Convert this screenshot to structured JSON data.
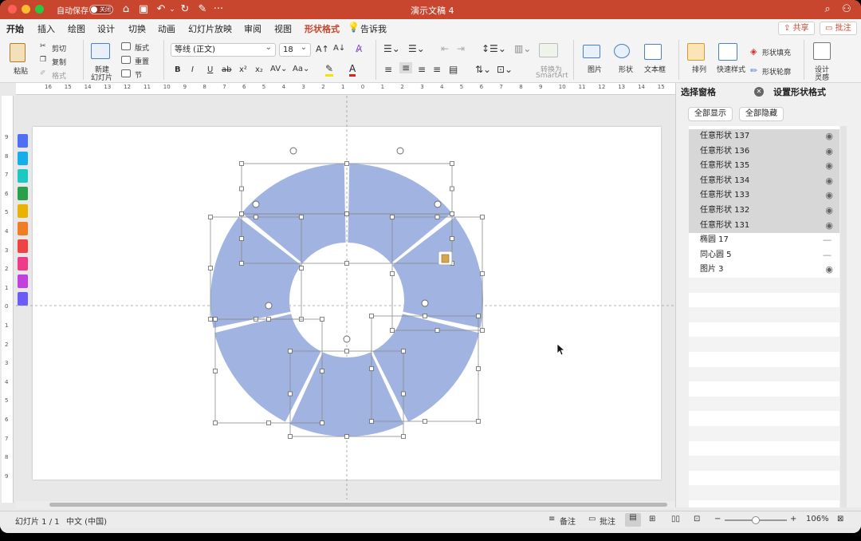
{
  "titlebar": {
    "autosave_label": "自动保存",
    "autosave_state": "关闭",
    "doc_title": "演示文稿 4",
    "more_icon": "···"
  },
  "tabs": [
    {
      "label": "开始"
    },
    {
      "label": "插入"
    },
    {
      "label": "绘图"
    },
    {
      "label": "设计"
    },
    {
      "label": "切换"
    },
    {
      "label": "动画"
    },
    {
      "label": "幻灯片放映"
    },
    {
      "label": "审阅"
    },
    {
      "label": "视图"
    },
    {
      "label": "形状格式"
    },
    {
      "label": "告诉我"
    }
  ],
  "share_label": "共享",
  "comment_label": "批注",
  "ribbon": {
    "paste": "粘贴",
    "cut": "剪切",
    "copy": "复制",
    "format": "格式",
    "new_slide_1": "新建",
    "new_slide_2": "幻灯片",
    "layout": "版式",
    "reset": "重置",
    "section": "节",
    "font_name": "等线 (正文)",
    "font_size": "18",
    "bold": "B",
    "italic": "I",
    "underline": "U",
    "strike": "ab",
    "superscript": "x²",
    "subscript": "x₂",
    "convert_1": "转换为",
    "convert_2": "SmartArt",
    "picture": "图片",
    "shape": "形状",
    "textbox": "文本框",
    "arrange": "排列",
    "quick_style": "快速样式",
    "shape_fill": "形状填充",
    "shape_outline": "形状轮廓",
    "design_1": "设计",
    "design_2": "灵感"
  },
  "ruler_h_ticks": [
    "16",
    "15",
    "14",
    "13",
    "12",
    "11",
    "10",
    "9",
    "8",
    "7",
    "6",
    "5",
    "4",
    "3",
    "2",
    "1",
    "0",
    "1",
    "2",
    "3",
    "4",
    "5",
    "6",
    "7",
    "8",
    "9",
    "10",
    "11",
    "12",
    "13",
    "14",
    "15",
    "16"
  ],
  "ruler_v_ticks": [
    "9",
    "8",
    "7",
    "6",
    "5",
    "4",
    "3",
    "2",
    "1",
    "0",
    "1",
    "2",
    "3",
    "4",
    "5",
    "6",
    "7",
    "8",
    "9"
  ],
  "palette_colors": [
    "#4f6ef7",
    "#14aeea",
    "#19c9c2",
    "#2aa04a",
    "#eab200",
    "#f07c24",
    "#ef4444",
    "#ef3b8a",
    "#c23fe0",
    "#6b5cf5"
  ],
  "donut": {
    "fill": "#a0b3e1",
    "segments": 7
  },
  "selection_pane": {
    "tab_selection": "选择窗格",
    "tab_format": "设置形状格式",
    "show_all": "全部显示",
    "hide_all": "全部隐藏",
    "items": [
      {
        "name": "任意形状 137",
        "visible": true,
        "selected": true
      },
      {
        "name": "任意形状 136",
        "visible": true,
        "selected": true
      },
      {
        "name": "任意形状 135",
        "visible": true,
        "selected": true
      },
      {
        "name": "任意形状 134",
        "visible": true,
        "selected": true
      },
      {
        "name": "任意形状 133",
        "visible": true,
        "selected": true
      },
      {
        "name": "任意形状 132",
        "visible": true,
        "selected": true
      },
      {
        "name": "任意形状 131",
        "visible": true,
        "selected": true
      },
      {
        "name": "椭圆 17",
        "visible": false,
        "selected": false
      },
      {
        "name": "同心圆 5",
        "visible": false,
        "selected": false
      },
      {
        "name": "图片 3",
        "visible": true,
        "selected": false
      }
    ]
  },
  "status": {
    "slide_info": "幻灯片 1 / 1",
    "language": "中文 (中国)",
    "notes": "备注",
    "comments": "批注",
    "zoom": "106%",
    "zoom_fraction": 0.5
  }
}
